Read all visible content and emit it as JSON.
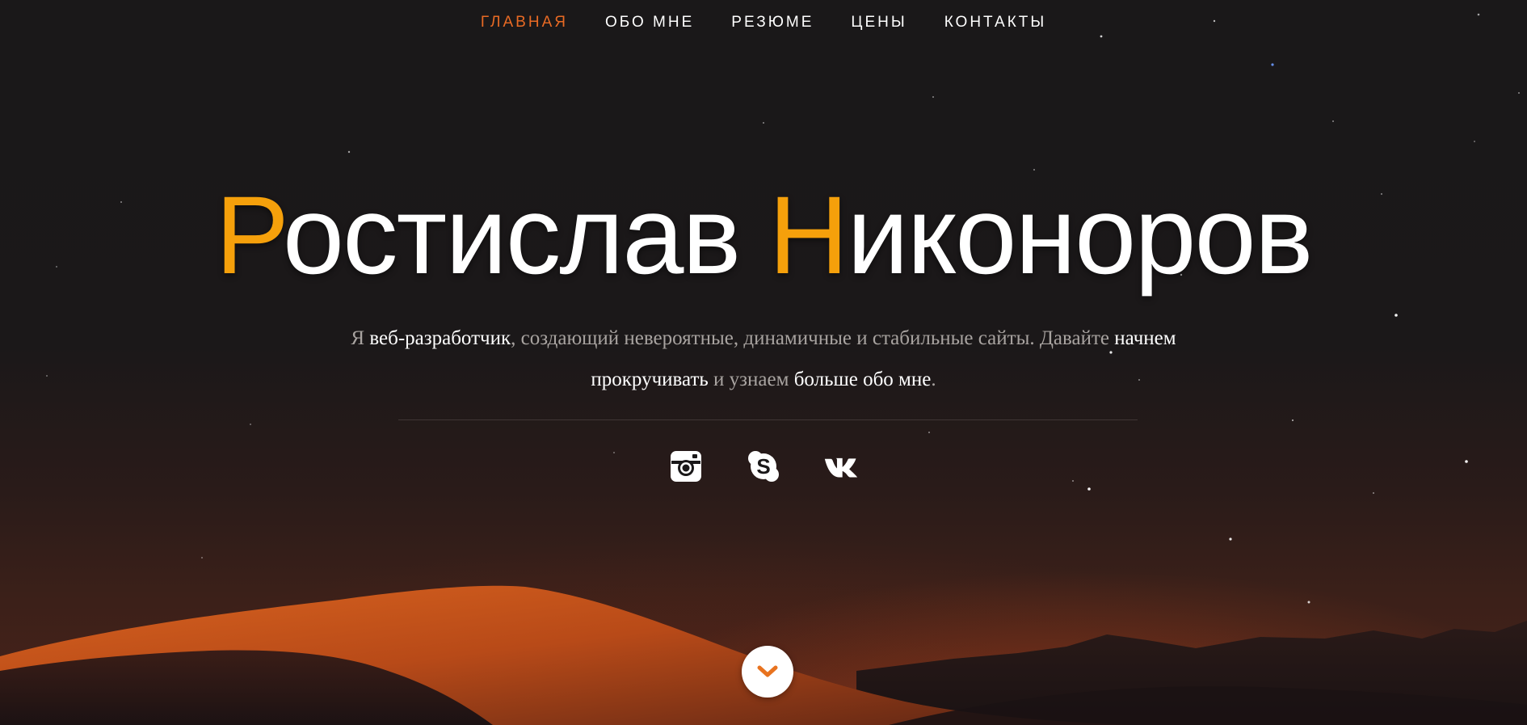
{
  "nav": {
    "items": [
      {
        "label": "ГЛАВНАЯ",
        "active": true
      },
      {
        "label": "ОБО МНЕ",
        "active": false
      },
      {
        "label": "РЕЗЮМЕ",
        "active": false
      },
      {
        "label": "ЦЕНЫ",
        "active": false
      },
      {
        "label": "КОНТАКТЫ",
        "active": false
      }
    ]
  },
  "hero": {
    "first_initial": "Р",
    "first_rest": "остислав",
    "last_initial": "Н",
    "last_rest": "иконоров",
    "subtitle_parts": [
      {
        "text": "Я ",
        "highlight": false
      },
      {
        "text": "веб-разработчик",
        "highlight": true
      },
      {
        "text": ", создающий невероятные, динамичные и стабильные сайты. Давайте ",
        "highlight": false
      },
      {
        "text": "начнем прокручивать",
        "highlight": true
      },
      {
        "text": " и узнаем ",
        "highlight": false
      },
      {
        "text": "больше обо мне",
        "highlight": true
      },
      {
        "text": ".",
        "highlight": false
      }
    ]
  },
  "social": [
    {
      "icon": "instagram-icon"
    },
    {
      "icon": "skype-icon"
    },
    {
      "icon": "vk-icon"
    }
  ],
  "scroll": {
    "icon": "chevron-down-icon"
  },
  "colors": {
    "accent_name": "#f5a00b",
    "nav_active": "#e86a24",
    "scroll_chevron": "#e8731f",
    "background": "#1a1819"
  }
}
